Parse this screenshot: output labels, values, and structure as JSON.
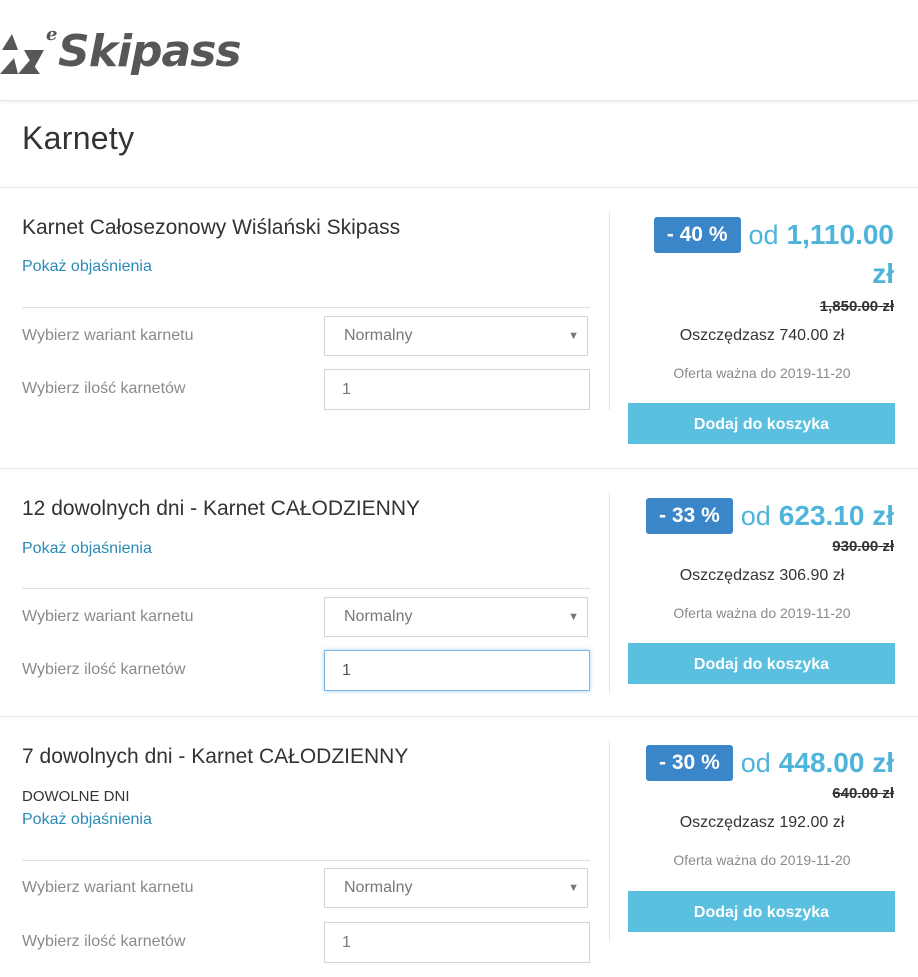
{
  "header": {
    "logo_prefix": "e",
    "logo_text": "Skipass",
    "logo_icon": "mountain-triangle-icon"
  },
  "page": {
    "title": "Karnety"
  },
  "colors": {
    "accent": "#4fb4da",
    "badge": "#3a86c8",
    "button": "#5bbfe0",
    "link": "#2a8bb6"
  },
  "products": [
    {
      "name": "Karnet Całosezonowy Wiślański Skipass",
      "subtitle": "",
      "link": "Pokaż objaśnienia",
      "variant_label": "Wybierz wariant karnetu",
      "variant_value": "Normalny",
      "qty_label": "Wybierz ilość karnetów",
      "qty_value": "1",
      "discount": "- 40 %",
      "price_prefix": "od",
      "price": "1,110.00",
      "currency": "zł",
      "old_price": "1,850.00 zł",
      "saving": "Oszczędzasz 740.00 zł",
      "valid_until": "Oferta ważna do 2019-11-20",
      "button": "Dodaj do koszyka"
    },
    {
      "name": "12 dowolnych dni - Karnet CAŁODZIENNY",
      "subtitle": "",
      "link": "Pokaż objaśnienia",
      "variant_label": "Wybierz wariant karnetu",
      "variant_value": "Normalny",
      "qty_label": "Wybierz ilość karnetów",
      "qty_value": "1",
      "discount": "- 33 %",
      "price_prefix": "od",
      "price": "623.10 zł",
      "old_price": "930.00 zł",
      "saving": "Oszczędzasz 306.90 zł",
      "valid_until": "Oferta ważna do 2019-11-20",
      "button": "Dodaj do koszyka"
    },
    {
      "name": "7 dowolnych dni - Karnet CAŁODZIENNY",
      "subtitle": "DOWOLNE DNI",
      "link": "Pokaż objaśnienia",
      "variant_label": "Wybierz wariant karnetu",
      "variant_value": "Normalny",
      "qty_label": "Wybierz ilość karnetów",
      "qty_value": "1",
      "discount": "- 30 %",
      "price_prefix": "od",
      "price": "448.00 zł",
      "old_price": "640.00 zł",
      "saving": "Oszczędzasz 192.00 zł",
      "valid_until": "Oferta ważna do 2019-11-20",
      "button": "Dodaj do koszyka"
    }
  ]
}
